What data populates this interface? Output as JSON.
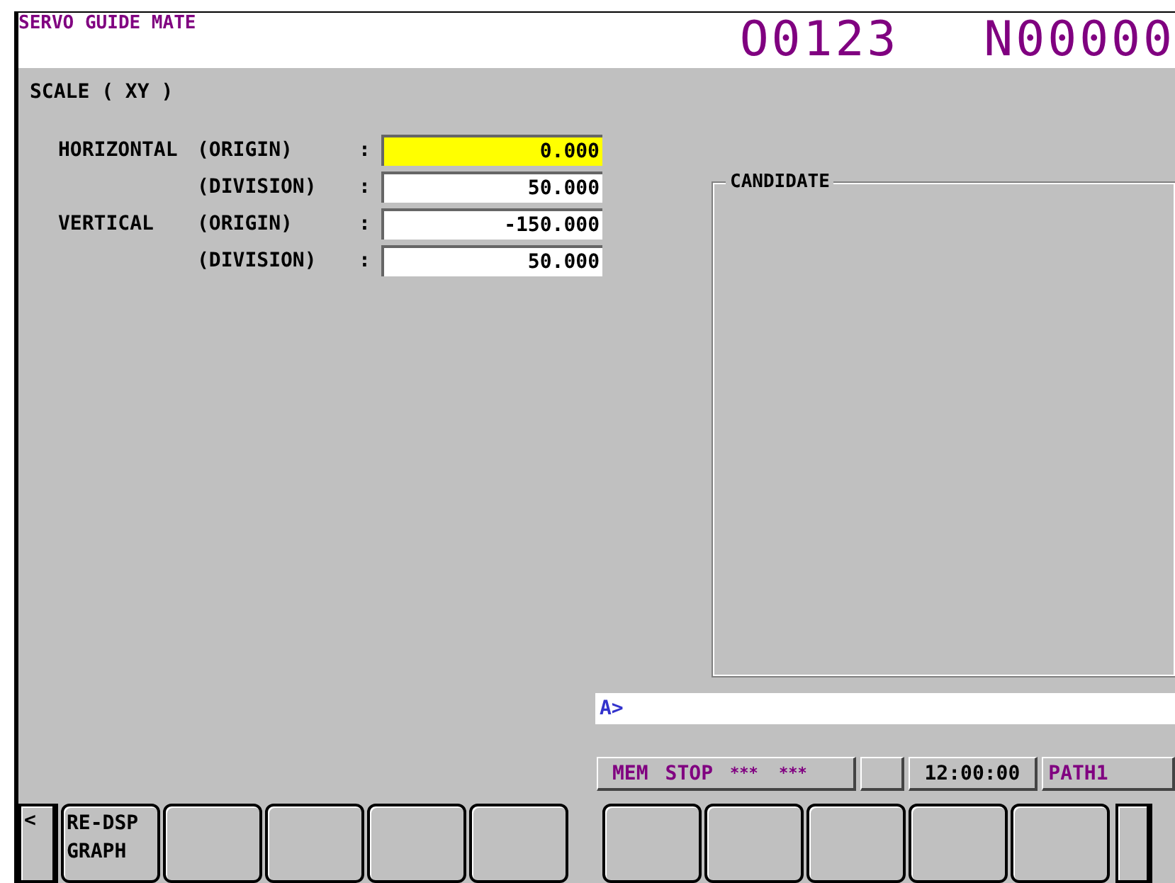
{
  "header": {
    "app_title": "SERVO GUIDE MATE",
    "program_number": "O0123",
    "sequence_number": "N00000"
  },
  "screen_title": "SCALE ( XY )",
  "fields": [
    {
      "group": "HORIZONTAL",
      "label": "(ORIGIN)",
      "value": "0.000",
      "selected": true
    },
    {
      "label": "(DIVISION)",
      "value": "50.000",
      "selected": false
    },
    {
      "group": "VERTICAL",
      "label": "(ORIGIN)",
      "value": "-150.000",
      "selected": false
    },
    {
      "label": "(DIVISION)",
      "value": "50.000",
      "selected": false
    }
  ],
  "separator": ":",
  "candidate": {
    "title": "CANDIDATE"
  },
  "input_line": {
    "prompt": "A>"
  },
  "status_bar": {
    "mode": "MEM",
    "state": "STOP",
    "alarm": "*** ***",
    "time": "12:00:00",
    "path": "PATH1"
  },
  "softkeys": {
    "left_arrow": "<",
    "keys": [
      {
        "kind": "labeled",
        "lines": [
          "RE-DSP",
          "GRAPH"
        ]
      },
      {
        "kind": "blank"
      },
      {
        "kind": "blank"
      },
      {
        "kind": "blank"
      },
      {
        "kind": "blank"
      },
      {
        "kind": "blank"
      },
      {
        "kind": "blank"
      },
      {
        "kind": "blank"
      },
      {
        "kind": "blank"
      },
      {
        "kind": "blank"
      }
    ],
    "right_key": {
      "kind": "blank"
    }
  }
}
